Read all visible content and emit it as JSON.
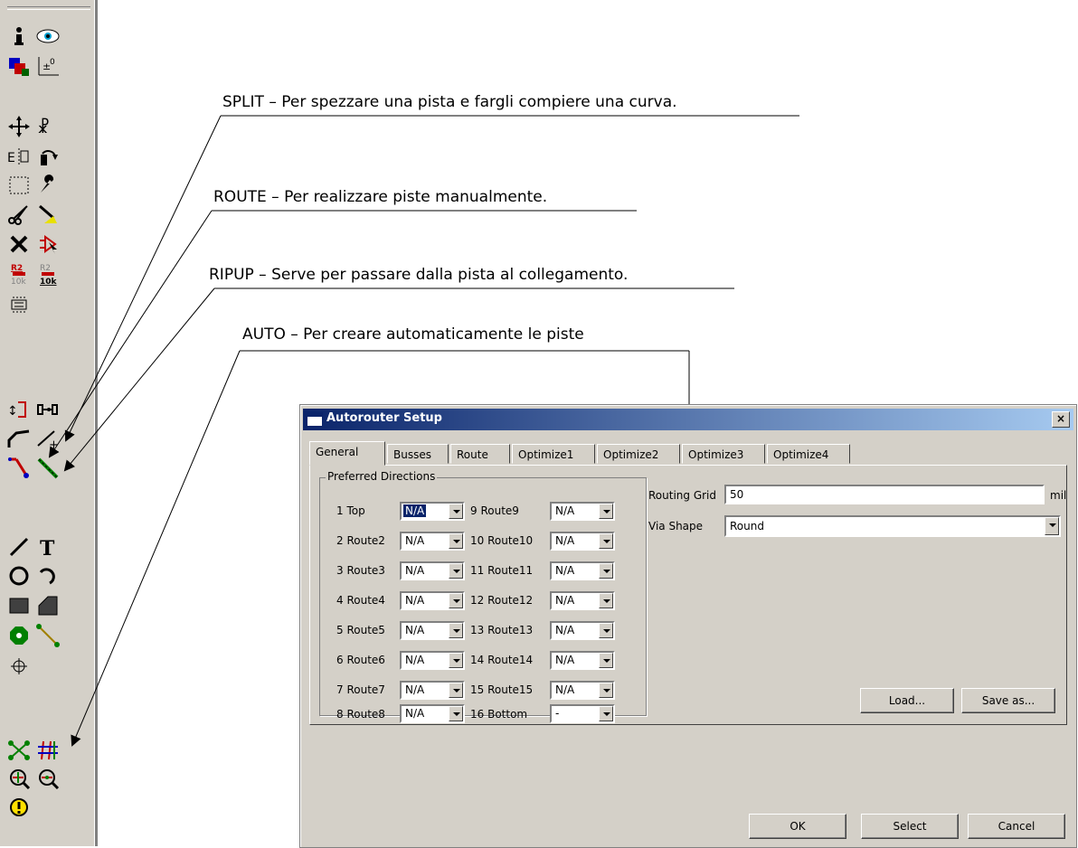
{
  "annotations": {
    "split": "SPLIT – Per spezzare una pista e fargli compiere una curva.",
    "route": "ROUTE – Per realizzare piste manualmente.",
    "ripup": "RIPUP – Serve per passare dalla pista al collegamento.",
    "auto": "AUTO – Per creare automaticamente le piste"
  },
  "toolbar": {
    "icons": [
      "info-icon",
      "show-icon",
      "display-layers-icon",
      "mark-icon",
      "move-icon",
      "copy-icon",
      "mirror-icon",
      "rotate-icon",
      "group-icon",
      "change-icon",
      "cut-icon",
      "paste-icon",
      "delete-icon",
      "add-icon",
      "name-icon",
      "value-icon",
      "smash-icon",
      "miter-icon",
      "split-icon",
      "optimize-icon",
      "route-icon",
      "ripup-icon",
      "wire-icon",
      "text-icon",
      "circle-icon",
      "arc-icon",
      "rect-icon",
      "polygon-icon",
      "via-icon",
      "signal-icon",
      "hole-icon",
      "ratsnest-icon",
      "auto-icon",
      "drc-icon",
      "errors-icon",
      "erc-icon"
    ]
  },
  "dialog": {
    "title": "Autorouter Setup",
    "close_label": "×",
    "tabs": [
      "General",
      "Busses",
      "Route",
      "Optimize1",
      "Optimize2",
      "Optimize3",
      "Optimize4"
    ],
    "group_title": "Preferred Directions",
    "layers_left": [
      {
        "label": "1 Top",
        "value": "N/A"
      },
      {
        "label": "2 Route2",
        "value": "N/A"
      },
      {
        "label": "3 Route3",
        "value": "N/A"
      },
      {
        "label": "4 Route4",
        "value": "N/A"
      },
      {
        "label": "5 Route5",
        "value": "N/A"
      },
      {
        "label": "6 Route6",
        "value": "N/A"
      },
      {
        "label": "7 Route7",
        "value": "N/A"
      },
      {
        "label": "8 Route8",
        "value": "N/A"
      }
    ],
    "layers_right": [
      {
        "label": "9 Route9",
        "value": "N/A"
      },
      {
        "label": "10 Route10",
        "value": "N/A"
      },
      {
        "label": "11 Route11",
        "value": "N/A"
      },
      {
        "label": "12 Route12",
        "value": "N/A"
      },
      {
        "label": "13 Route13",
        "value": "N/A"
      },
      {
        "label": "14 Route14",
        "value": "N/A"
      },
      {
        "label": "15 Route15",
        "value": "N/A"
      },
      {
        "label": "16 Bottom",
        "value": "-"
      }
    ],
    "routing_grid_label": "Routing Grid",
    "routing_grid_value": "50",
    "routing_grid_unit": "mil",
    "via_shape_label": "Via Shape",
    "via_shape_value": "Round",
    "load_label": "Load...",
    "save_as_label": "Save as...",
    "ok_label": "OK",
    "select_label": "Select",
    "cancel_label": "Cancel"
  }
}
